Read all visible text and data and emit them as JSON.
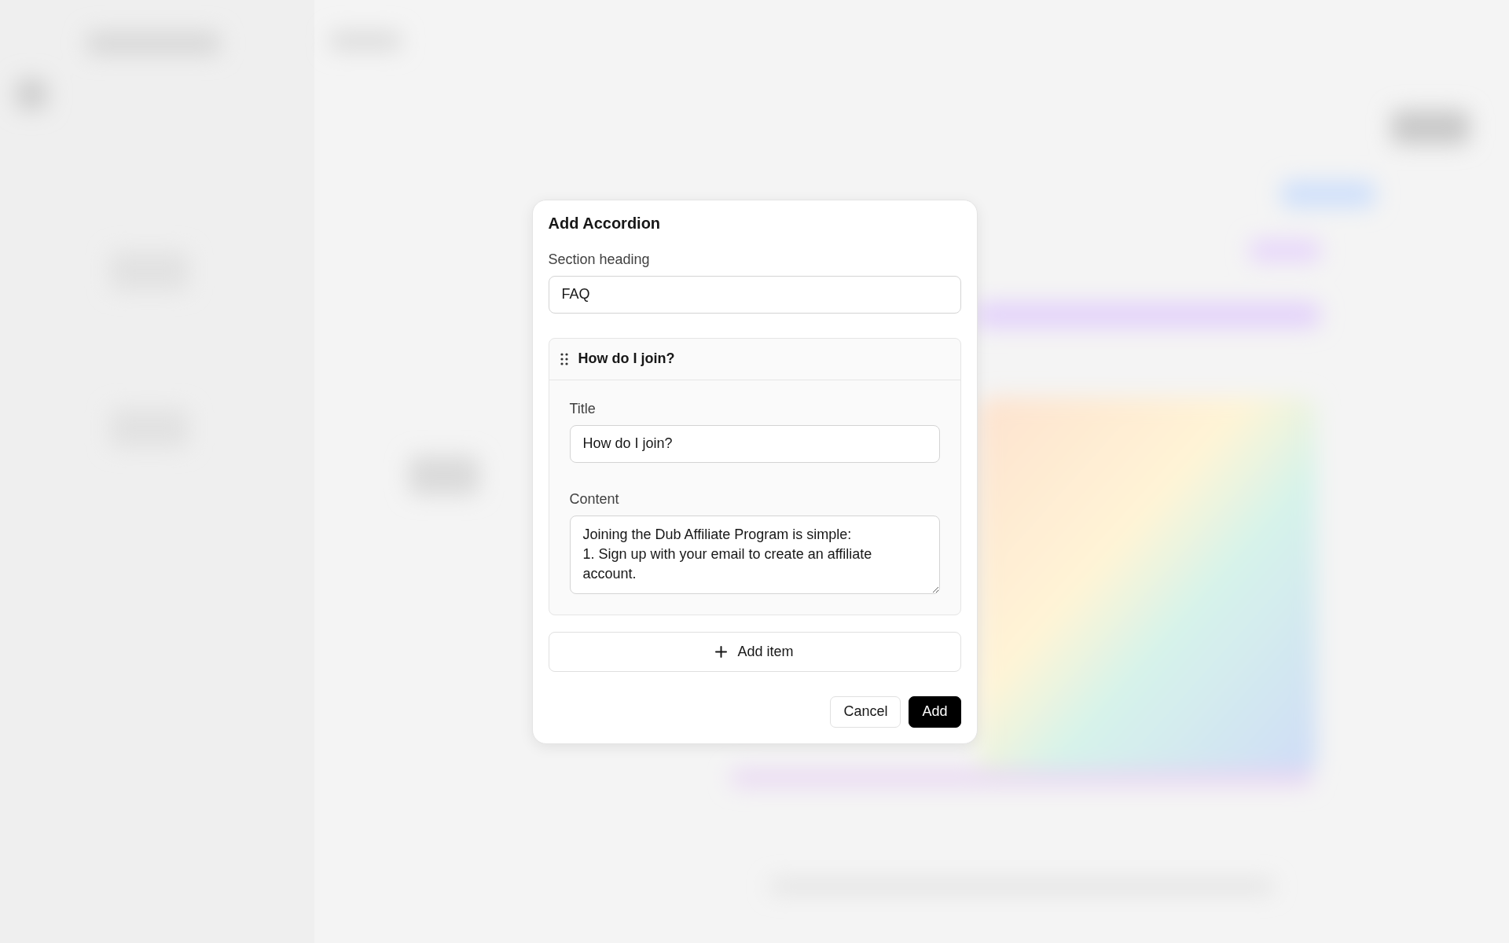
{
  "dialog": {
    "title": "Add Accordion",
    "section_heading": {
      "label": "Section heading",
      "value": "FAQ"
    },
    "items": [
      {
        "header": "How do I join?",
        "expanded": true,
        "title_label": "Title",
        "title_value": "How do I join?",
        "content_label": "Content",
        "content_value": "Joining the Dub Affiliate Program is simple:\n1. Sign up with your email to create an affiliate account."
      }
    ],
    "add_item_button": "Add item",
    "buttons": [
      {
        "label": "Cancel",
        "kind": "secondary"
      },
      {
        "label": "Add",
        "kind": "primary"
      }
    ]
  }
}
